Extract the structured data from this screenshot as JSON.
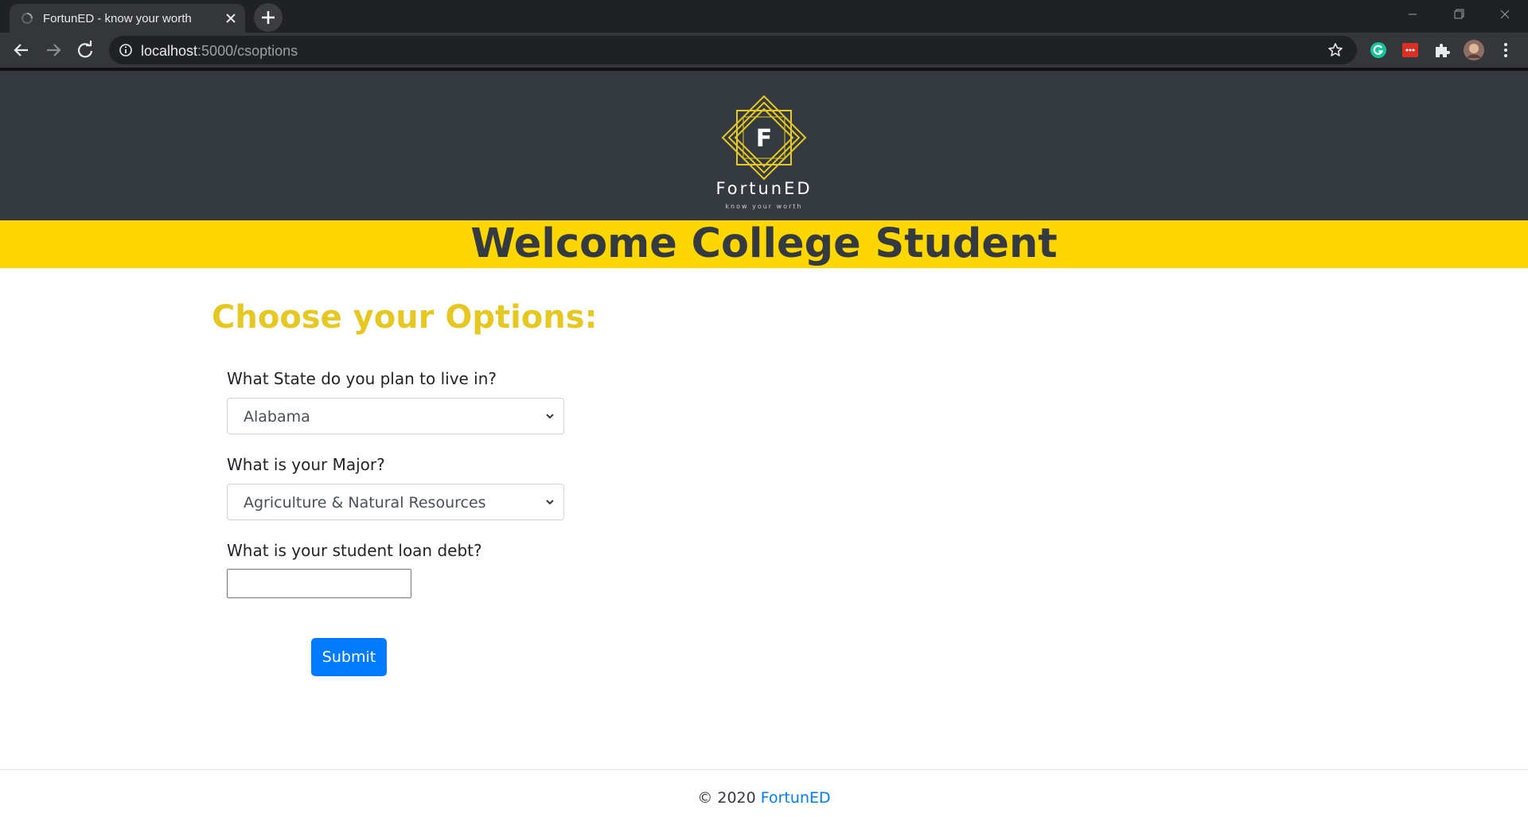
{
  "browser": {
    "tab_title": "FortunED - know your worth",
    "url_host": "localhost",
    "url_rest": ":5000/csoptions",
    "icons": {
      "tab_favicon": "loading-spinner-icon",
      "tab_close": "close-icon",
      "new_tab": "plus-icon",
      "back": "back-arrow-icon",
      "forward": "forward-arrow-icon",
      "reload": "reload-icon",
      "site_info": "info-icon",
      "bookmark": "star-icon",
      "grammarly": "grammarly-icon",
      "extension_red": "red-extension-icon",
      "extensions": "puzzle-icon",
      "profile": "avatar",
      "menu": "kebab-menu-icon"
    }
  },
  "header": {
    "logo_letter": "F",
    "brand_name": "FortunED",
    "brand_tagline": "know your worth",
    "background_color": "#343a40",
    "logo_color": "#e5c823"
  },
  "welcome": {
    "title": "Welcome College Student",
    "band_color": "#ffd700"
  },
  "form": {
    "heading": "Choose your Options:",
    "heading_color": "#e5c823",
    "state": {
      "label": "What State do you plan to live in?",
      "selected": "Alabama"
    },
    "major": {
      "label": "What is your Major?",
      "selected": "Agriculture & Natural Resources"
    },
    "debt": {
      "label": "What is your student loan debt?",
      "value": ""
    },
    "submit_label": "Submit",
    "submit_color": "#007bff"
  },
  "footer": {
    "copyright": "© 2020",
    "link_text": "FortunED"
  }
}
